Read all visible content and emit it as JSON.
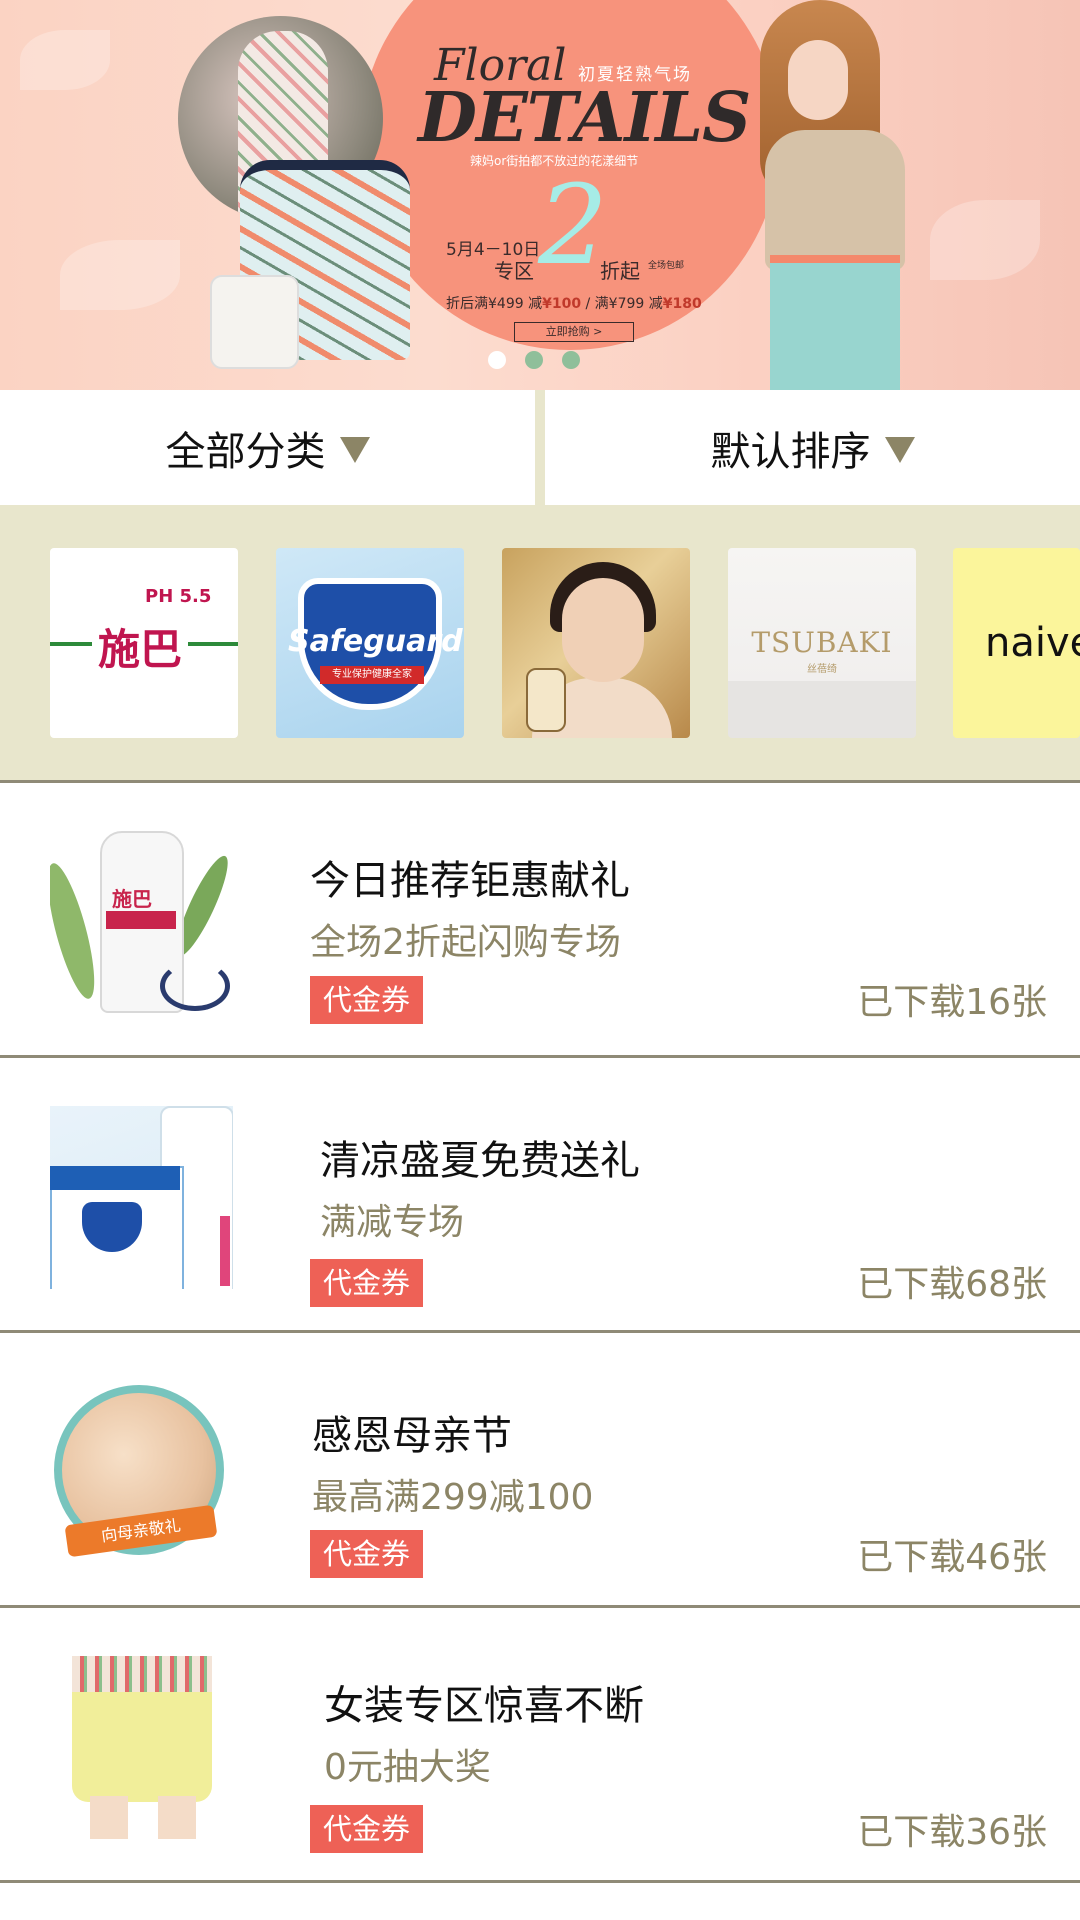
{
  "banner": {
    "title_script": "Floral",
    "title_main": "DETAILS",
    "subtitle": "初夏轻熟气场",
    "tagline": "辣妈or街拍都不放过的花漾细节",
    "date": "5月4－10日",
    "zone": "专区",
    "discount_number": "2",
    "discount_suffix": "折起",
    "free_shipping": "全场包邮",
    "promo_prefix": "折后满¥499 减",
    "promo_amount1": "¥100",
    "promo_mid": " / 满¥799 减",
    "promo_amount2": "¥180",
    "buy_now": "立即抢购 >",
    "slide_count": 3,
    "active_slide": 1
  },
  "filters": {
    "category_label": "全部分类",
    "sort_label": "默认排序"
  },
  "brands": {
    "b1_name": "施巴",
    "b1_ph": "PH 5.5",
    "b2_name": "Safeguard",
    "b2_tag": "专业保护健康全家",
    "b4_name": "TSUBAKI",
    "b4_sub": "丝蓓绮",
    "b5_name": "naive"
  },
  "list": [
    {
      "title": "今日推荐钜惠献礼",
      "subtitle": "全场2折起闪购专场",
      "coupon": "代金券",
      "downloads": "已下载16张"
    },
    {
      "title": "清凉盛夏免费送礼",
      "subtitle": "满减专场",
      "coupon": "代金券",
      "downloads": "已下载68张"
    },
    {
      "title": "感恩母亲节",
      "subtitle": "最高满299减100",
      "coupon": "代金券",
      "downloads": "已下载46张",
      "thumb_ribbon": "向母亲敬礼"
    },
    {
      "title": "女装专区惊喜不断",
      "subtitle": "0元抽大奖",
      "coupon": "代金券",
      "downloads": "已下载36张"
    }
  ],
  "colors": {
    "accent_coupon": "#ee6156",
    "muted_text": "#8c8566",
    "strip_bg": "#e8e6cc"
  }
}
